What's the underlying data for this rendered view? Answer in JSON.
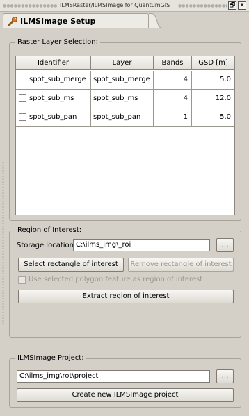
{
  "window": {
    "title": "ILMSRaster/ILMSImage for QuantumGIS",
    "restore_glyph": "🗗",
    "close_glyph": "✕"
  },
  "tab": {
    "label": "ILMSImage Setup",
    "icon": "wrench-icon"
  },
  "raster": {
    "title": "Raster Layer Selection:",
    "columns": [
      "Identifier",
      "Layer",
      "Bands",
      "GSD [m]"
    ],
    "rows": [
      {
        "identifier": "spot_sub_merge",
        "layer": "spot_sub_merge",
        "bands": "4",
        "gsd": "5.0",
        "checked": false
      },
      {
        "identifier": "spot_sub_ms",
        "layer": "spot_sub_ms",
        "bands": "4",
        "gsd": "12.0",
        "checked": false
      },
      {
        "identifier": "spot_sub_pan",
        "layer": "spot_sub_pan",
        "bands": "1",
        "gsd": "5.0",
        "checked": false
      }
    ]
  },
  "roi": {
    "title": "Region of Interest:",
    "storage_label": "Storage location:",
    "storage_value": "C:\\ilms_img\\_roi",
    "browse_label": "...",
    "select_rect_label": "Select rectangle of interest",
    "remove_rect_label": "Remove rectangle of interest",
    "use_polygon_label": "Use selected polygon feature as region of interest",
    "use_polygon_checked": false,
    "extract_label": "Extract region of interest"
  },
  "project": {
    "title": "ILMSImage Project:",
    "path_value": "C:\\ilms_img\\rot\\project",
    "browse_label": "...",
    "create_label": "Create new ILMSImage project"
  }
}
